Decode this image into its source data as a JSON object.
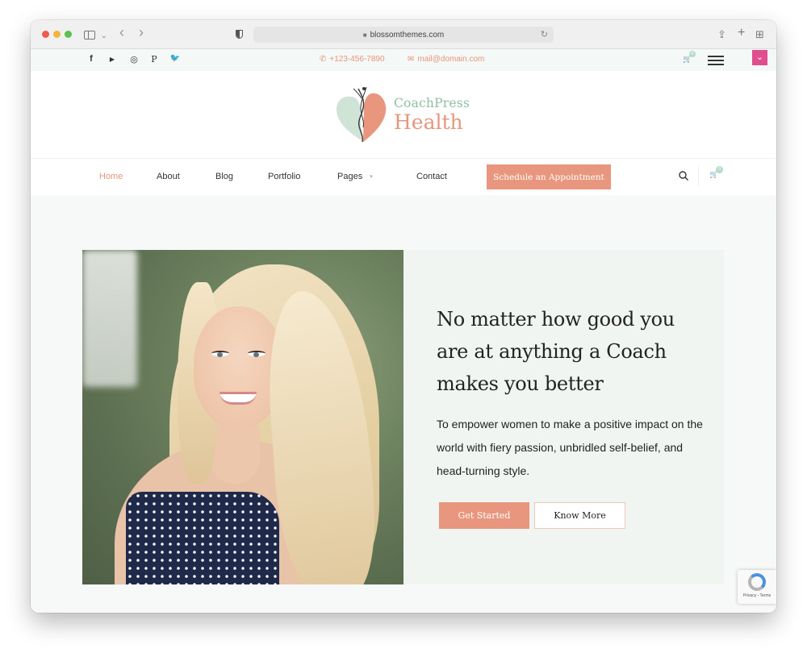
{
  "browser": {
    "url": "blossomthemes.com",
    "icons": [
      "sidebar-icon",
      "chevron-down-icon",
      "back-icon",
      "forward-icon",
      "shield-icon",
      "lock-icon",
      "reload-icon",
      "share-icon",
      "new-tab-icon",
      "tab-overview-icon"
    ],
    "glyphs": {
      "chevron": "⌄",
      "back": "‹",
      "forward": "›",
      "lock": "🔒",
      "reload": "↻",
      "share": "⇪",
      "plus": "+",
      "grid": "⊞"
    }
  },
  "topbar": {
    "social": [
      {
        "name": "facebook-icon",
        "glyph": "f"
      },
      {
        "name": "youtube-icon",
        "glyph": "▶"
      },
      {
        "name": "instagram-icon",
        "glyph": "◎"
      },
      {
        "name": "pinterest-icon",
        "glyph": "P"
      },
      {
        "name": "twitter-icon",
        "glyph": "🐦"
      }
    ],
    "phone": "+123-456-7890",
    "email": "mail@domain.com",
    "phone_glyph": "✆",
    "email_glyph": "✉",
    "cart_glyph": "🛒",
    "cart_count": "0",
    "toggle_glyph": "⌄"
  },
  "logo": {
    "line1": "CoachPress",
    "line2": "Health"
  },
  "nav": {
    "items": [
      {
        "label": "Home",
        "active": true
      },
      {
        "label": "About"
      },
      {
        "label": "Blog"
      },
      {
        "label": "Portfolio"
      },
      {
        "label": "Pages",
        "has_dropdown": true
      },
      {
        "label": "Contact"
      }
    ],
    "caret": "▾",
    "cta": "Schedule an Appointment",
    "cart_glyph": "🛒",
    "cart_count": "0"
  },
  "hero": {
    "headline": "No matter how good you are at anything a Coach makes you better",
    "subtext": "To empower women to make a positive impact on the world with fiery passion, unbridled self-belief, and head-turning style.",
    "primary_button": "Get Started",
    "secondary_button": "Know More",
    "image_alt": "Smiling blonde woman in polka dot dress"
  },
  "recaptcha": {
    "text": "Privacy - Terms"
  },
  "colors": {
    "accent": "#e8977e",
    "logo_green": "#8fbfa1",
    "pink_toggle": "#e04f8d",
    "hero_bg": "#f1f5f2"
  }
}
